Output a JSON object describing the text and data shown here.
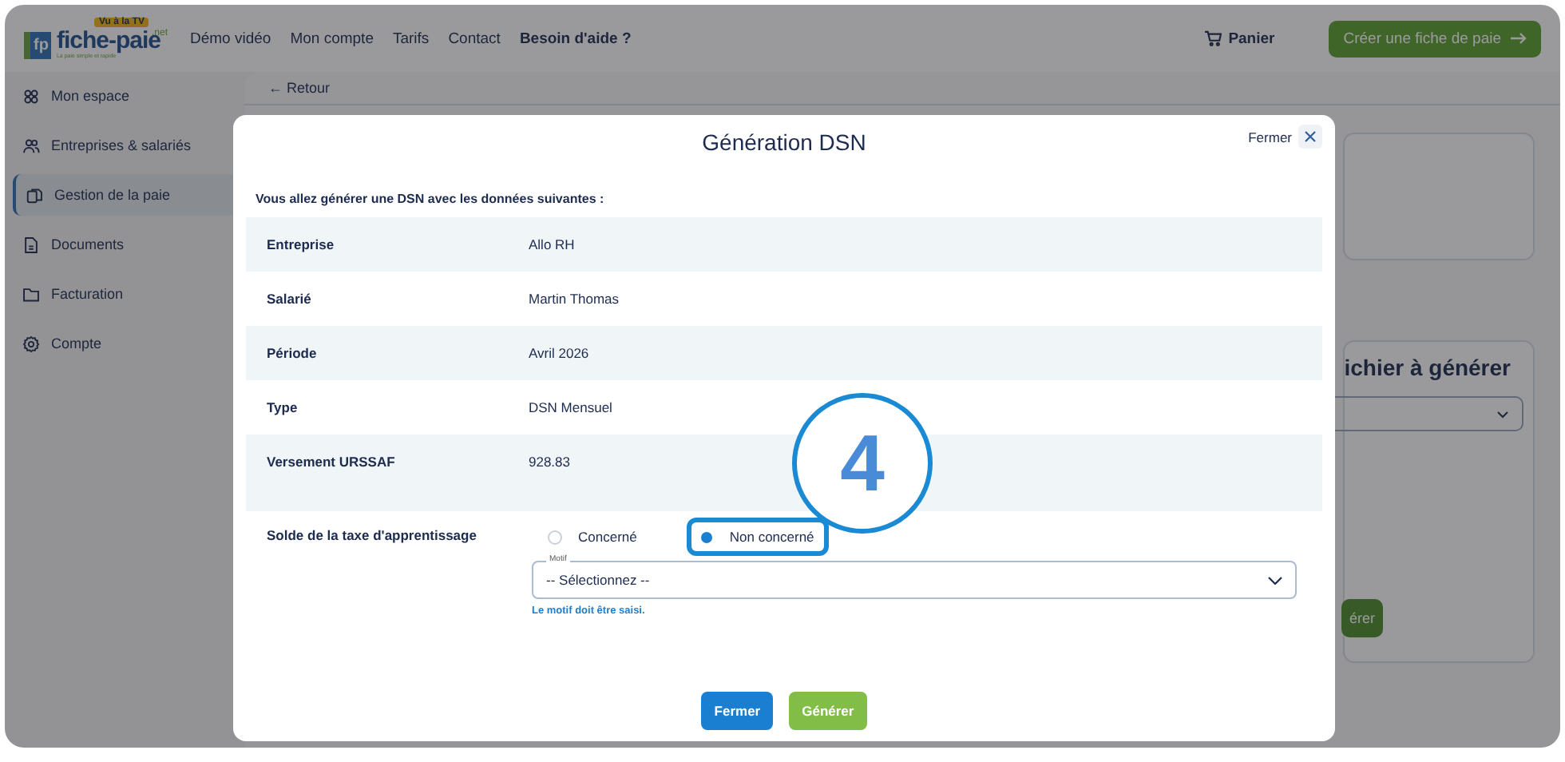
{
  "header": {
    "logo": {
      "badge": "Vu à la TV",
      "initials": "fp",
      "name": "fiche-paie",
      "suffix": ".net",
      "tagline": "La paie simple et rapide"
    },
    "nav": [
      {
        "label": "Démo vidéo",
        "strong": false
      },
      {
        "label": "Mon compte",
        "strong": false
      },
      {
        "label": "Tarifs",
        "strong": false
      },
      {
        "label": "Contact",
        "strong": false
      },
      {
        "label": "Besoin d'aide ?",
        "strong": true
      }
    ],
    "cart": "Panier",
    "cta": "Créer une fiche de paie"
  },
  "sidebar": {
    "items": [
      {
        "label": "Mon espace",
        "selected": false
      },
      {
        "label": "Entreprises & salariés",
        "selected": false
      },
      {
        "label": "Gestion de la paie",
        "selected": true
      },
      {
        "label": "Documents",
        "selected": false
      },
      {
        "label": "Facturation",
        "selected": false
      },
      {
        "label": "Compte",
        "selected": false
      }
    ]
  },
  "page": {
    "back_arrow": "←",
    "back": "Retour",
    "panel_heading": "ichier à générer",
    "panel_button": "érer"
  },
  "modal": {
    "title": "Génération DSN",
    "close_label": "Fermer",
    "intro": "Vous allez générer une DSN avec les données suivantes :",
    "rows": [
      {
        "label": "Entreprise",
        "value": "Allo RH"
      },
      {
        "label": "Salarié",
        "value": "Martin Thomas"
      },
      {
        "label": "Période",
        "value": "Avril 2026"
      },
      {
        "label": "Type",
        "value": "DSN Mensuel"
      },
      {
        "label": "Versement URSSAF",
        "value": "928.83"
      }
    ],
    "tax": {
      "label": "Solde de la taxe d'apprentissage",
      "options": [
        {
          "label": "Concerné",
          "selected": false,
          "highlighted": false
        },
        {
          "label": "Non concerné",
          "selected": true,
          "highlighted": true
        }
      ],
      "select": {
        "label": "Motif",
        "value": "-- Sélectionnez --"
      },
      "error": "Le motif doit être saisi."
    },
    "buttons": [
      {
        "label": "Fermer",
        "kind": "primary"
      },
      {
        "label": "Générer",
        "kind": "success"
      }
    ]
  },
  "annotation": {
    "number": "4"
  }
}
